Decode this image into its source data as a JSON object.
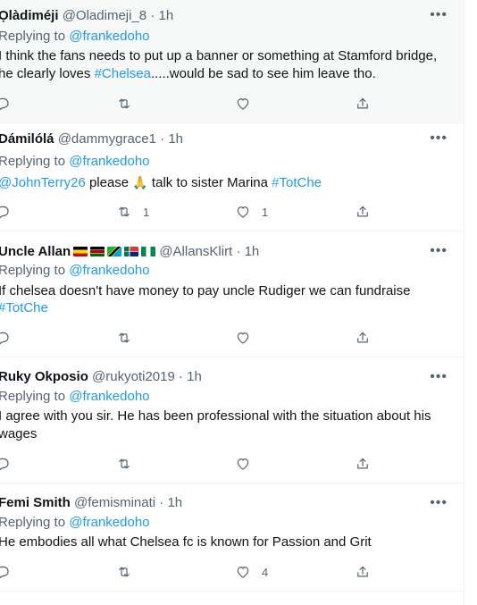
{
  "tweets": [
    {
      "name": "Ọlàdiméji",
      "handle": "@Oladimeji_8",
      "dot": "·",
      "time": "1h",
      "replying_prefix": "Replying to",
      "replying_to": "@frankedoho",
      "line1": "I think the fans needs to put up a banner or something at Stamford bridge,",
      "line2_pre": "he clearly loves ",
      "line2_tag": "#Chelsea",
      "line2_post": ".....would be sad to see him leave tho.",
      "reply_count": "",
      "retweet_count": "",
      "like_count": ""
    },
    {
      "name": "Dámilólá",
      "handle": "@dammygrace1",
      "dot": "·",
      "time": "1h",
      "replying_prefix": "Replying to",
      "replying_to": "@frankedoho",
      "mention": "@JohnTerry26",
      "text_a": " please ",
      "emoji": "🙏",
      "text_b": " talk to sister Marina ",
      "tag": "#TotChe",
      "reply_count": "",
      "retweet_count": "1",
      "like_count": "1"
    },
    {
      "name": "Uncle Allan",
      "handle": "@AllansKlirt",
      "dot": "·",
      "time": "1h",
      "replying_prefix": "Replying to",
      "replying_to": "@frankedoho",
      "line1": "If chelsea doesn't have money to pay uncle Rudiger we can fundraise",
      "tag": "#TotChe",
      "reply_count": "",
      "retweet_count": "",
      "like_count": ""
    },
    {
      "name": "Ruky Okposio",
      "handle": "@rukyoti2019",
      "dot": "·",
      "time": "1h",
      "replying_prefix": "Replying to",
      "replying_to": "@frankedoho",
      "line1": "I agree with you sir. He has been professional with the situation about his",
      "line2": "wages",
      "reply_count": "",
      "retweet_count": "",
      "like_count": ""
    },
    {
      "name": "Femi Smith",
      "handle": "@femisminati",
      "dot": "·",
      "time": "1h",
      "replying_prefix": "Replying to",
      "replying_to": "@frankedoho",
      "line1": "He embodies all what Chelsea fc is known for Passion and Grit",
      "reply_count": "",
      "retweet_count": "",
      "like_count": "4"
    }
  ],
  "more_label": "•••",
  "colors": {
    "link": "#1d9bf0",
    "muted": "#536471",
    "text": "#0f1419",
    "divider": "#eff3f4",
    "highlight": "#f7f9f9"
  },
  "icons": [
    "reply-icon",
    "retweet-icon",
    "like-icon",
    "share-icon",
    "more-icon",
    "flag-icon",
    "folded-hands-emoji"
  ]
}
